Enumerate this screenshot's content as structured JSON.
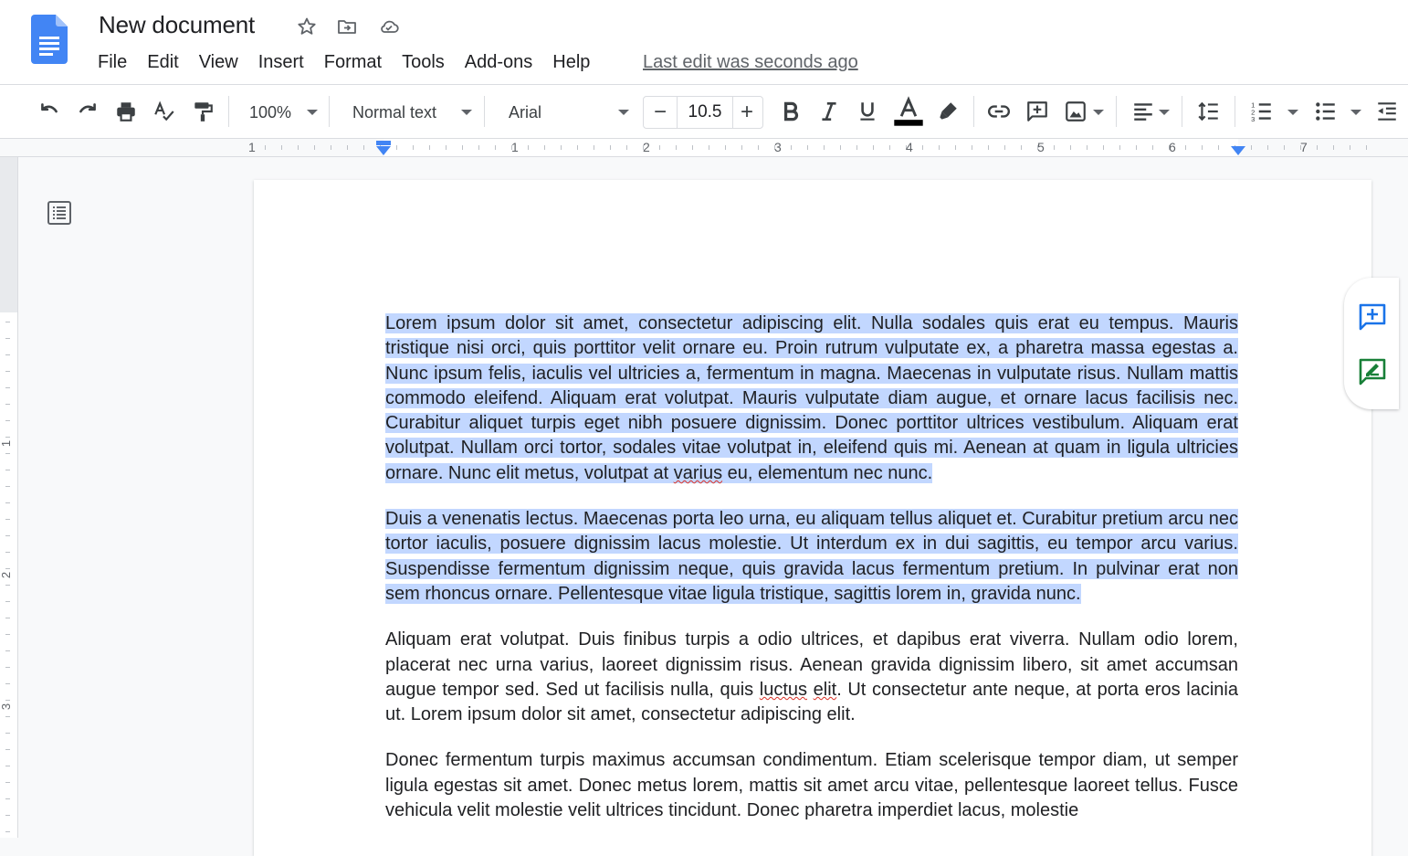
{
  "app": {
    "doc_title": "New document",
    "last_edit": "Last edit was seconds ago",
    "colors": {
      "brand_blue": "#4285f4",
      "selection": "#c2d7ff",
      "green": "#188038"
    }
  },
  "menu": [
    "File",
    "Edit",
    "View",
    "Insert",
    "Format",
    "Tools",
    "Add-ons",
    "Help"
  ],
  "toolbar": {
    "zoom": "100%",
    "style": "Normal text",
    "font": "Arial",
    "font_size": "10.5",
    "minus": "−",
    "plus": "+"
  },
  "ruler": {
    "h_labels": [
      "1",
      "1",
      "2",
      "3",
      "4",
      "5",
      "6",
      "7"
    ],
    "v_labels": [
      "1",
      "2",
      "3"
    ]
  },
  "document": {
    "p1a": "Lorem ipsum dolor sit amet, consectetur adipiscing elit. Nulla sodales quis erat eu tempus. Mauris tristique nisi orci, quis porttitor velit ornare eu. Proin rutrum vulputate ex, a pharetra massa egestas a. Nunc ipsum felis, iaculis vel ultricies a, fermentum in magna. Maecenas in vulputate risus. Nullam mattis commodo eleifend. Aliquam erat volutpat. Mauris vulputate diam augue, et ornare lacus facilisis nec. Curabitur aliquet turpis eget nibh posuere dignissim. Donec porttitor ultrices vestibulum. Aliquam erat volutpat. Nullam orci tortor, sodales vitae volutpat in, eleifend quis mi. Aenean at quam in ligula ultricies ornare. Nunc elit metus, volutpat at ",
    "p1_spell": "varius",
    "p1b": " eu, elementum nec nunc.",
    "p2": "Duis a venenatis lectus. Maecenas porta leo urna, eu aliquam tellus aliquet et. Curabitur pretium arcu nec tortor iaculis, posuere dignissim lacus molestie. Ut interdum ex in dui sagittis, eu tempor arcu varius. Suspendisse fermentum dignissim neque, quis gravida lacus fermentum pretium. In pulvinar erat non sem rhoncus ornare. Pellentesque vitae ligula tristique, sagittis lorem in, gravida nunc.",
    "p3a": "Aliquam erat volutpat. Duis finibus turpis a odio ultrices, et dapibus erat viverra. Nullam odio lorem, placerat nec urna varius, laoreet dignissim risus. Aenean gravida dignissim libero, sit amet accumsan augue tempor sed. Sed ut facilisis nulla, quis ",
    "p3_spell1": "luctus",
    "p3_space": " ",
    "p3_spell2": "elit",
    "p3b": ". Ut consectetur ante neque, at porta eros lacinia ut. Lorem ipsum dolor sit amet, consectetur adipiscing elit.",
    "p4": "Donec fermentum turpis maximus accumsan condimentum. Etiam scelerisque tempor diam, ut semper ligula egestas sit amet. Donec metus lorem, mattis sit amet arcu vitae, pellentesque laoreet tellus. Fusce vehicula velit molestie velit ultrices tincidunt. Donec pharetra imperdiet lacus, molestie"
  }
}
